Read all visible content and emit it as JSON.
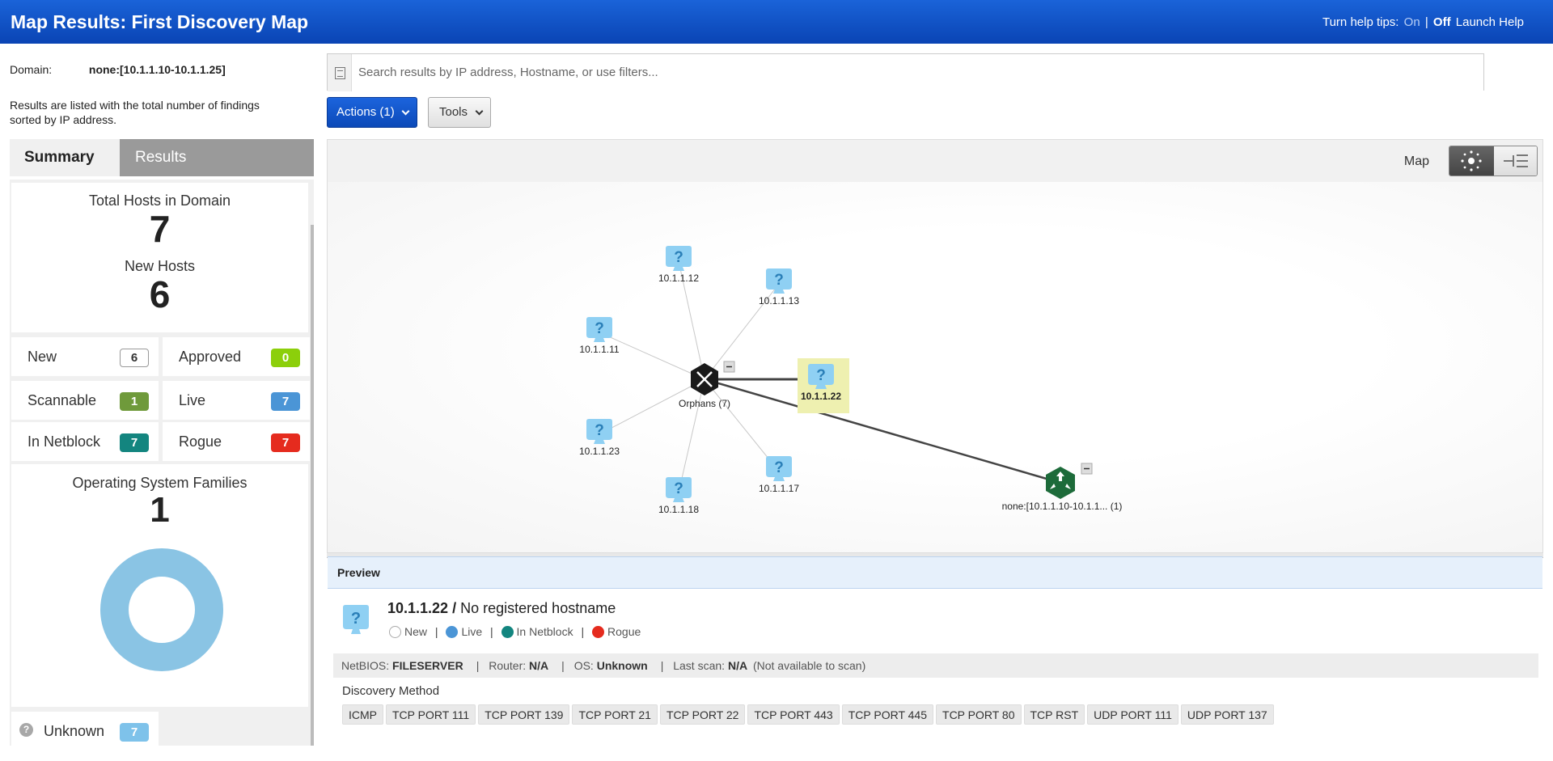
{
  "header": {
    "title": "Map Results: First Discovery Map",
    "tips_label": "Turn help tips:",
    "tips_on": "On",
    "tips_sep": "|",
    "tips_off": "Off",
    "launch_help": "Launch Help"
  },
  "left": {
    "domain_label": "Domain:",
    "domain_value": "none:[10.1.1.10-10.1.1.25]",
    "description": "Results are listed with the total number of findings sorted by IP address.",
    "tabs": {
      "summary": "Summary",
      "results": "Results"
    },
    "totals": {
      "total_hosts_label": "Total Hosts in Domain",
      "total_hosts": "7",
      "new_hosts_label": "New Hosts",
      "new_hosts": "6"
    },
    "stats": [
      {
        "label": "New",
        "value": "6",
        "color": "#ffffff"
      },
      {
        "label": "Approved",
        "value": "0",
        "color": "#8ccf0b"
      },
      {
        "label": "Scannable",
        "value": "1",
        "color": "#6f9a3b"
      },
      {
        "label": "Live",
        "value": "7",
        "color": "#4b95d6"
      },
      {
        "label": "In Netblock",
        "value": "7",
        "color": "#13857f"
      },
      {
        "label": "Rogue",
        "value": "7",
        "color": "#e52b1e"
      }
    ],
    "os": {
      "label": "Operating System Families",
      "count": "1",
      "unknown_label": "Unknown",
      "unknown_count": "7",
      "donut_color": "#8ac4e4"
    }
  },
  "search": {
    "placeholder": "Search results by IP address, Hostname, or use filters..."
  },
  "toolbar": {
    "actions": "Actions (1)",
    "tools": "Tools"
  },
  "map": {
    "view_label": "Map",
    "hub_label": "Orphans (7)",
    "domain_node_label": "none:[10.1.1.10-10.1.1... (1)",
    "hosts": [
      "10.1.1.12",
      "10.1.1.13",
      "10.1.1.11",
      "10.1.1.22",
      "10.1.1.23",
      "10.1.1.17",
      "10.1.1.18"
    ],
    "selected_host": "10.1.1.22"
  },
  "preview": {
    "heading": "Preview",
    "ip": "10.1.1.22",
    "sep": "/",
    "hostname": "No registered hostname",
    "legend": [
      {
        "label": "New",
        "color": "#ffffff"
      },
      {
        "label": "Live",
        "color": "#4b95d6"
      },
      {
        "label": "In Netblock",
        "color": "#13857f"
      },
      {
        "label": "Rogue",
        "color": "#e52b1e"
      }
    ],
    "netbios_label": "NetBIOS:",
    "netbios_value": "FILESERVER",
    "router_label": "Router:",
    "router_value": "N/A",
    "os_label": "OS:",
    "os_value": "Unknown",
    "last_scan_label": "Last scan:",
    "last_scan_value": "N/A",
    "last_scan_note": "(Not available to scan)",
    "discovery_label": "Discovery Method",
    "methods": [
      "ICMP",
      "TCP PORT 111",
      "TCP PORT 139",
      "TCP PORT 21",
      "TCP PORT 22",
      "TCP PORT 443",
      "TCP PORT 445",
      "TCP PORT 80",
      "TCP RST",
      "UDP PORT 111",
      "UDP PORT 137"
    ]
  }
}
